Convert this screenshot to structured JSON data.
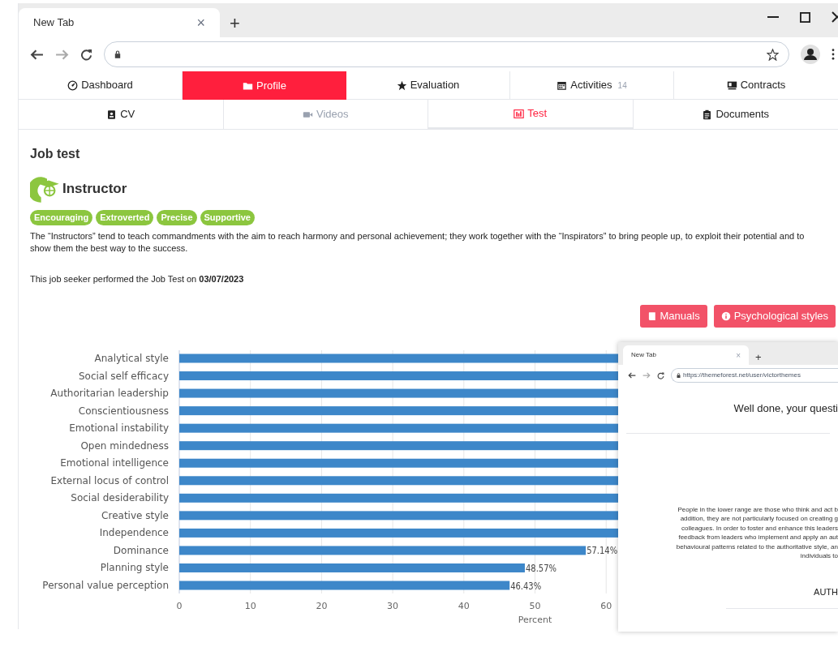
{
  "browser": {
    "tab_title": "New Tab",
    "tab_close": "×",
    "new_tab": "+"
  },
  "nav_tabs": [
    {
      "label": "Dashboard",
      "selected": false
    },
    {
      "label": "Profile",
      "selected": true
    },
    {
      "label": "Evaluation",
      "selected": false
    },
    {
      "label": "Activities",
      "count": "14",
      "selected": false
    },
    {
      "label": "Contracts",
      "selected": false
    }
  ],
  "sub_tabs": [
    {
      "label": "CV",
      "selected": false,
      "disabled": false
    },
    {
      "label": "Videos",
      "selected": false,
      "disabled": true
    },
    {
      "label": "Test",
      "selected": true,
      "disabled": false
    },
    {
      "label": "Documents",
      "selected": false,
      "disabled": false
    }
  ],
  "section_title": "Job test",
  "profile": {
    "name": "Instructor",
    "tags": [
      "Encouraging",
      "Extroverted",
      "Precise",
      "Supportive"
    ],
    "description": "The “Instructors” tend to teach commandments with the aim to reach harmony and personal achievement; they work together with the “Inspirators” to bring people up, to exploit their potential and to show them the best way to the success.",
    "test_date": "This job seeker performed the Job Test on **03/07/2023**"
  },
  "buttons": [
    "Manuals",
    "Psychological styles"
  ],
  "chart_data": {
    "type": "bar",
    "orientation": "horizontal",
    "grid": true,
    "xlabel": "Percent",
    "categories": [
      "Analytical style",
      "Social self efficacy",
      "Authoritarian leadership",
      "Conscientiousness",
      "Emotional instability",
      "Open mindedness",
      "Emotional intelligence",
      "External locus of control",
      "Social desiderability",
      "Creative style",
      "Independence",
      "Dominance",
      "Planning style",
      "Personal value perception"
    ],
    "series": [
      {
        "color": "#3d87c9",
        "values": [
          61.8,
          61.8,
          61.8,
          61.8,
          61.8,
          61.8,
          61.8,
          61.8,
          61.8,
          61.7,
          61.7,
          57.14,
          48.57,
          46.43
        ]
      }
    ],
    "value_labels": [
      null,
      null,
      null,
      null,
      null,
      null,
      null,
      null,
      null,
      null,
      null,
      "57.14%",
      "48.57%",
      "46.43%"
    ],
    "xlim": [
      0,
      61.8
    ],
    "xticks": [
      0,
      10,
      20,
      30,
      40,
      50,
      60
    ]
  },
  "overlay_window": {
    "tab_title": "New Tab",
    "tab_close": "×",
    "new_tab": "+",
    "url": "https://themeforest.net/user/victorthemes",
    "heading": "Well done, your questi",
    "paragraph_lines": [
      "People in the lower range are those who think and act b",
      "addition, they are not particularly focused on creating g",
      "colleagues. In order to foster and enhance this leaders",
      "feedback from leaders who implement and apply an aut",
      "behavioural patterns related to the authoritative style, an",
      "individuals to"
    ],
    "footer_heading": "AUTH"
  }
}
